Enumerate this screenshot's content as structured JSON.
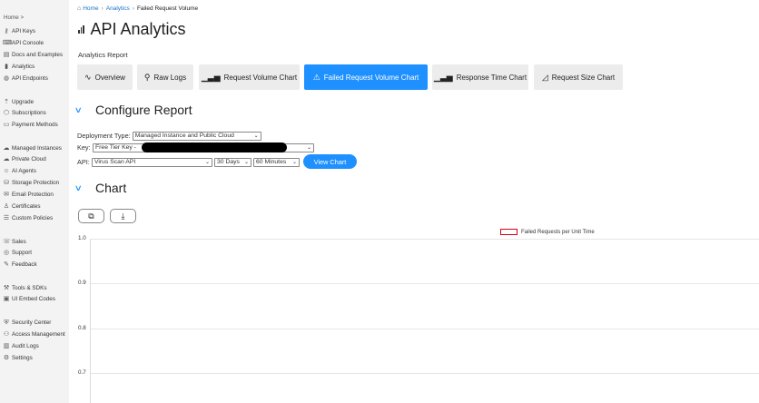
{
  "sidebar": {
    "home": "Home >",
    "items": [
      {
        "label": "API Keys",
        "icon": "key-icon"
      },
      {
        "label": "API Console",
        "icon": "console-icon"
      },
      {
        "label": "Docs and Examples",
        "icon": "docs-icon"
      },
      {
        "label": "Analytics",
        "icon": "bar-chart-icon"
      },
      {
        "label": "API Endpoints",
        "icon": "globe-icon"
      },
      {
        "label": "Upgrade",
        "icon": "rocket-icon"
      },
      {
        "label": "Subscriptions",
        "icon": "box-icon"
      },
      {
        "label": "Payment Methods",
        "icon": "card-icon"
      },
      {
        "label": "Managed Instances",
        "icon": "cloud-icon"
      },
      {
        "label": "Private Cloud",
        "icon": "cloud-lock-icon"
      },
      {
        "label": "AI Agents",
        "icon": "robot-icon"
      },
      {
        "label": "Storage Protection",
        "icon": "storage-icon"
      },
      {
        "label": "Email Protection",
        "icon": "mail-icon"
      },
      {
        "label": "Certificates",
        "icon": "certificate-icon"
      },
      {
        "label": "Custom Policies",
        "icon": "policy-icon"
      },
      {
        "label": "Sales",
        "icon": "phone-icon"
      },
      {
        "label": "Support",
        "icon": "support-icon"
      },
      {
        "label": "Feedback",
        "icon": "feedback-icon"
      },
      {
        "label": "Tools & SDKs",
        "icon": "wrench-icon"
      },
      {
        "label": "UI Embed Codes",
        "icon": "embed-icon"
      },
      {
        "label": "Security Center",
        "icon": "shield-icon"
      },
      {
        "label": "Access Management",
        "icon": "users-icon"
      },
      {
        "label": "Audit Logs",
        "icon": "log-icon"
      },
      {
        "label": "Settings",
        "icon": "gear-icon"
      }
    ]
  },
  "breadcrumb": {
    "home": "Home",
    "analytics": "Analytics",
    "current": "Failed Request Volume"
  },
  "page_title": "API Analytics",
  "report_label": "Analytics Report",
  "tabs": [
    {
      "label": "Overview",
      "icon": "pulse-icon"
    },
    {
      "label": "Raw Logs",
      "icon": "search-icon"
    },
    {
      "label": "Request Volume Chart",
      "icon": "bars-icon"
    },
    {
      "label": "Failed Request Volume Chart",
      "icon": "warning-icon"
    },
    {
      "label": "Response Time Chart",
      "icon": "bars-icon"
    },
    {
      "label": "Request Size Chart",
      "icon": "area-chart-icon"
    }
  ],
  "configure": {
    "heading": "Configure Report",
    "deployment_label": "Deployment Type:",
    "deployment_value": "Managed Instance and Public Cloud",
    "key_label": "Key:",
    "key_value": "Free Tier Key -",
    "api_label": "API:",
    "api_value": "Virus Scan API",
    "range_value": "30 Days",
    "interval_value": "60 Minutes",
    "view_button": "View Chart"
  },
  "chart_section": {
    "heading": "Chart"
  },
  "chart_data": {
    "type": "line",
    "series": [
      {
        "name": "Failed Requests per Unit Time",
        "values": []
      }
    ],
    "y_ticks": [
      "1.0",
      "0.9",
      "0.8",
      "0.7"
    ],
    "ylim": [
      0.7,
      1.0
    ],
    "legend_color": "#d0021b",
    "grid": true,
    "legend": "top"
  },
  "colors": {
    "accent": "#1e90ff",
    "sidebar_bg": "#f3f3f3"
  }
}
